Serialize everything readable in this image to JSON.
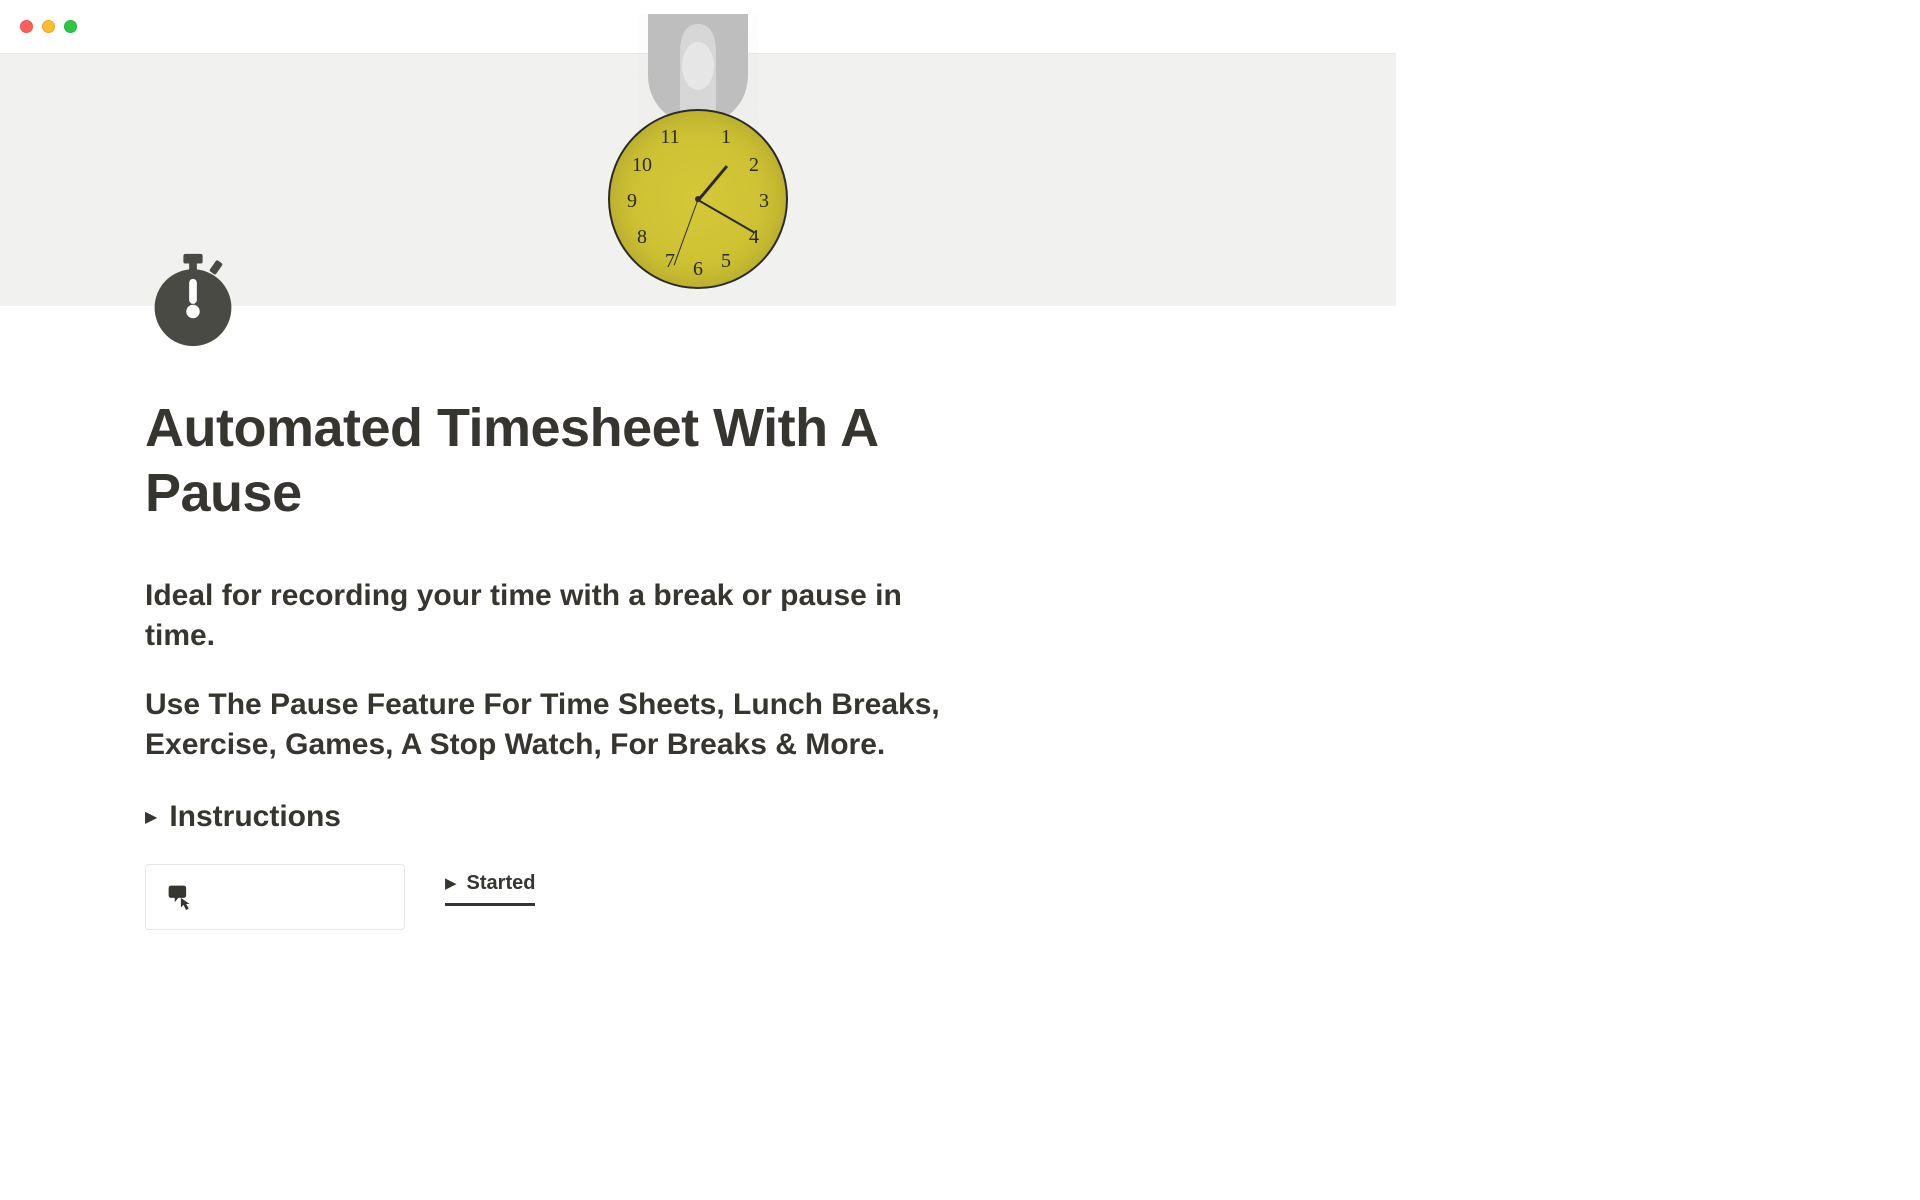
{
  "page": {
    "title": "Automated Timesheet With A Pause",
    "subtitle": "Ideal for recording your time with a break or pause in time.",
    "description": "Use The Pause Feature For Time Sheets, Lunch Breaks, Exercise, Games, A Stop Watch, For Breaks & More."
  },
  "toggles": {
    "instructions_label": "Instructions"
  },
  "tabs": {
    "started_label": "Started"
  },
  "clock_numbers": [
    "1",
    "2",
    "3",
    "4",
    "5",
    "6",
    "7",
    "8",
    "9",
    "10",
    "11"
  ],
  "icons": {
    "page_icon": "stopwatch-icon",
    "callout_icon": "pointer-icon"
  }
}
